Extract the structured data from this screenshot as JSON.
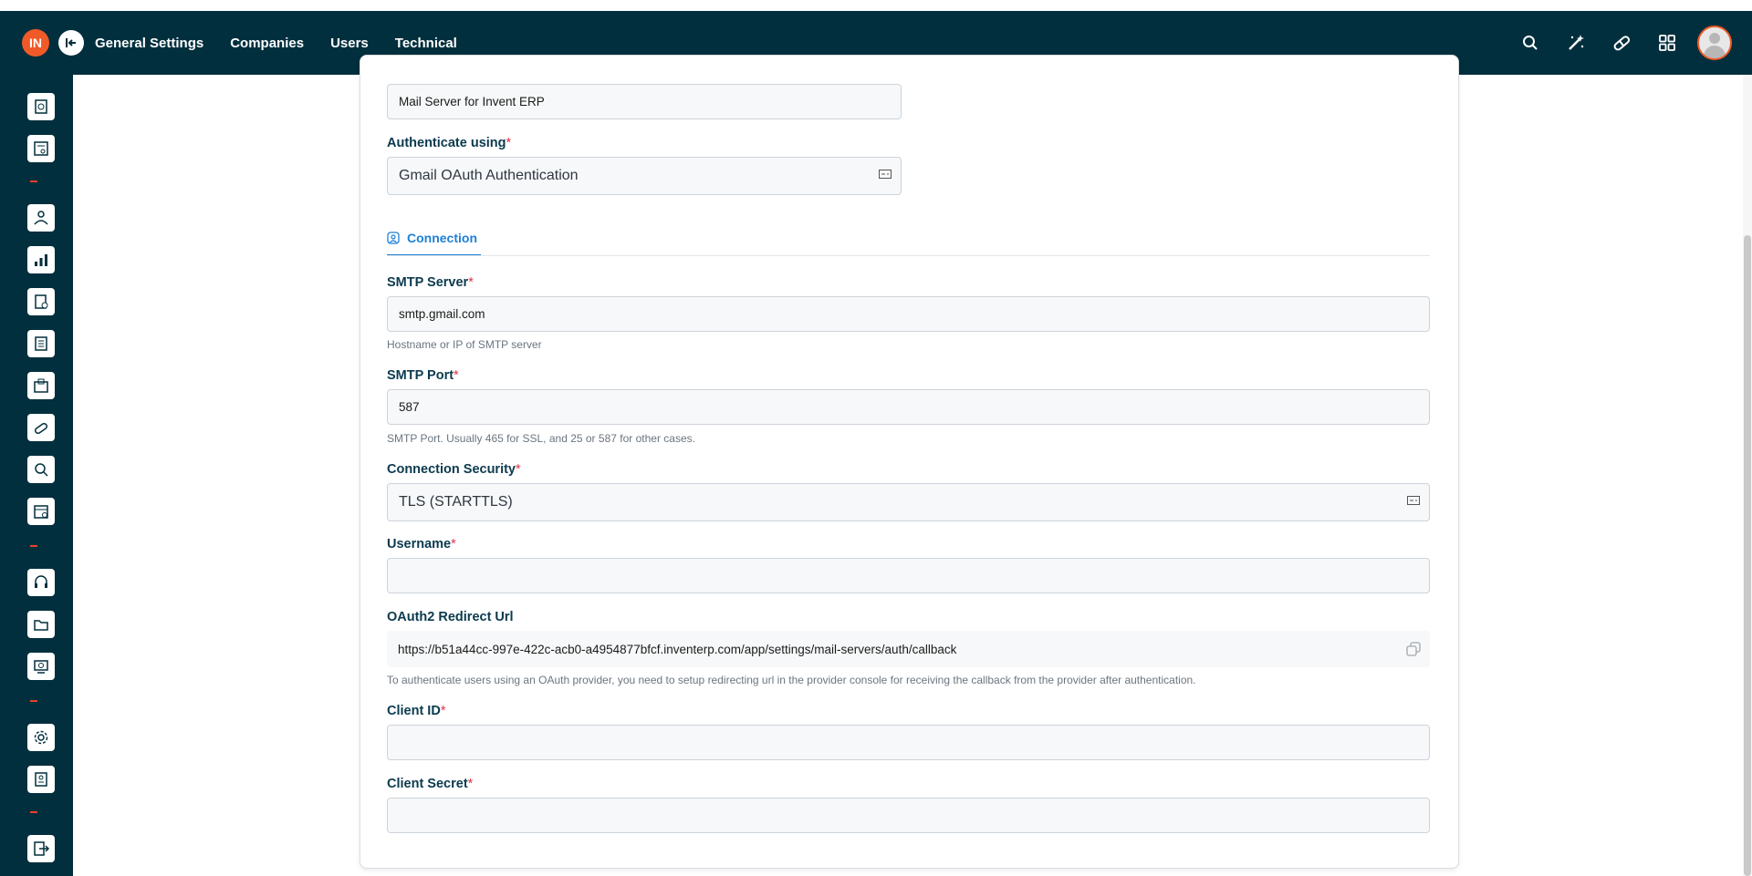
{
  "header": {
    "logo_text": "IN",
    "collapse_icon": "collapse-left-icon",
    "nav": [
      {
        "label": "General Settings"
      },
      {
        "label": "Companies"
      },
      {
        "label": "Users"
      },
      {
        "label": "Technical"
      }
    ],
    "icons": [
      "search-icon",
      "magic-wand-icon",
      "pill-icon",
      "apps-grid-icon",
      "user-avatar"
    ]
  },
  "sidebar": {
    "icons": [
      "dashboard-icon",
      "pos-icon",
      "crm-icon",
      "sales-chart-icon",
      "invoice-icon",
      "accounting-icon",
      "inventory-icon",
      "purchase-icon",
      "hr-search-icon",
      "calendar-icon",
      "helpdesk-icon",
      "documents-icon",
      "website-icon",
      "settings-gear-icon",
      "employee-card-icon",
      "logout-icon"
    ]
  },
  "form": {
    "description_value": "Mail Server for Invent ERP",
    "auth_label": "Authenticate using",
    "auth_value": "Gmail OAuth Authentication",
    "tab_label": "Connection",
    "smtp_server_label": "SMTP Server",
    "smtp_server_value": "smtp.gmail.com",
    "smtp_server_hint": "Hostname or IP of SMTP server",
    "smtp_port_label": "SMTP Port",
    "smtp_port_value": "587",
    "smtp_port_hint": "SMTP Port. Usually 465 for SSL, and 25 or 587 for other cases.",
    "security_label": "Connection Security",
    "security_value": "TLS (STARTTLS)",
    "username_label": "Username",
    "username_value": "",
    "redirect_label": "OAuth2 Redirect Url",
    "redirect_value": "https://b51a44cc-997e-422c-acb0-a4954877bfcf.inventerp.com/app/settings/mail-servers/auth/callback",
    "redirect_hint": "To authenticate users using an OAuth provider, you need to setup redirecting url in the provider console for receiving the callback from the provider after authentication.",
    "client_id_label": "Client ID",
    "client_id_value": "",
    "client_secret_label": "Client Secret",
    "client_secret_value": "",
    "required_mark": "*"
  },
  "colors": {
    "topbar": "#022f3d",
    "accent_blue": "#1e7fd6",
    "required_red": "#e0314a",
    "logo_orange": "#f05a28"
  }
}
